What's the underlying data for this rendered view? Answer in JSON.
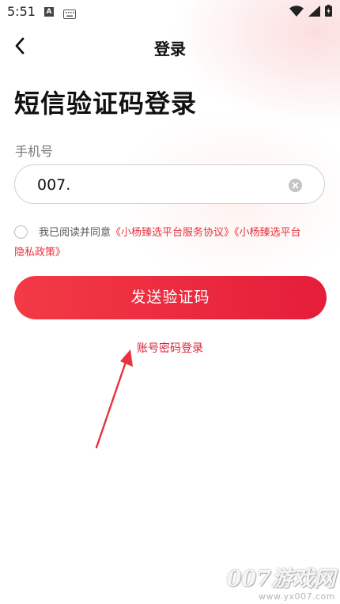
{
  "status_bar": {
    "time": "5:51",
    "icons": [
      "a-notification-icon",
      "keyboard-icon",
      "wifi-icon",
      "signal-icon",
      "battery-icon"
    ]
  },
  "nav": {
    "title": "登录",
    "back_icon": "chevron-left-icon"
  },
  "page_title": "短信验证码登录",
  "phone": {
    "label": "手机号",
    "value": "007.",
    "clear_icon": "clear-circle-icon"
  },
  "agreement": {
    "prefix": "我已阅读并同意",
    "link1": "《小杨臻选平台服务协议》",
    "link2_part1": "《小杨臻选平台",
    "link2_part2": "隐私政策》",
    "checked": false
  },
  "send_button": {
    "label": "发送验证码"
  },
  "password_login_link": "账号密码登录",
  "watermark": {
    "main": "007游戏网",
    "sub": "www.yx007.com"
  },
  "colors": {
    "accent": "#e8323e",
    "button_start": "#f33a45",
    "button_end": "#e51d3a",
    "annotation_arrow": "#e8323e"
  }
}
